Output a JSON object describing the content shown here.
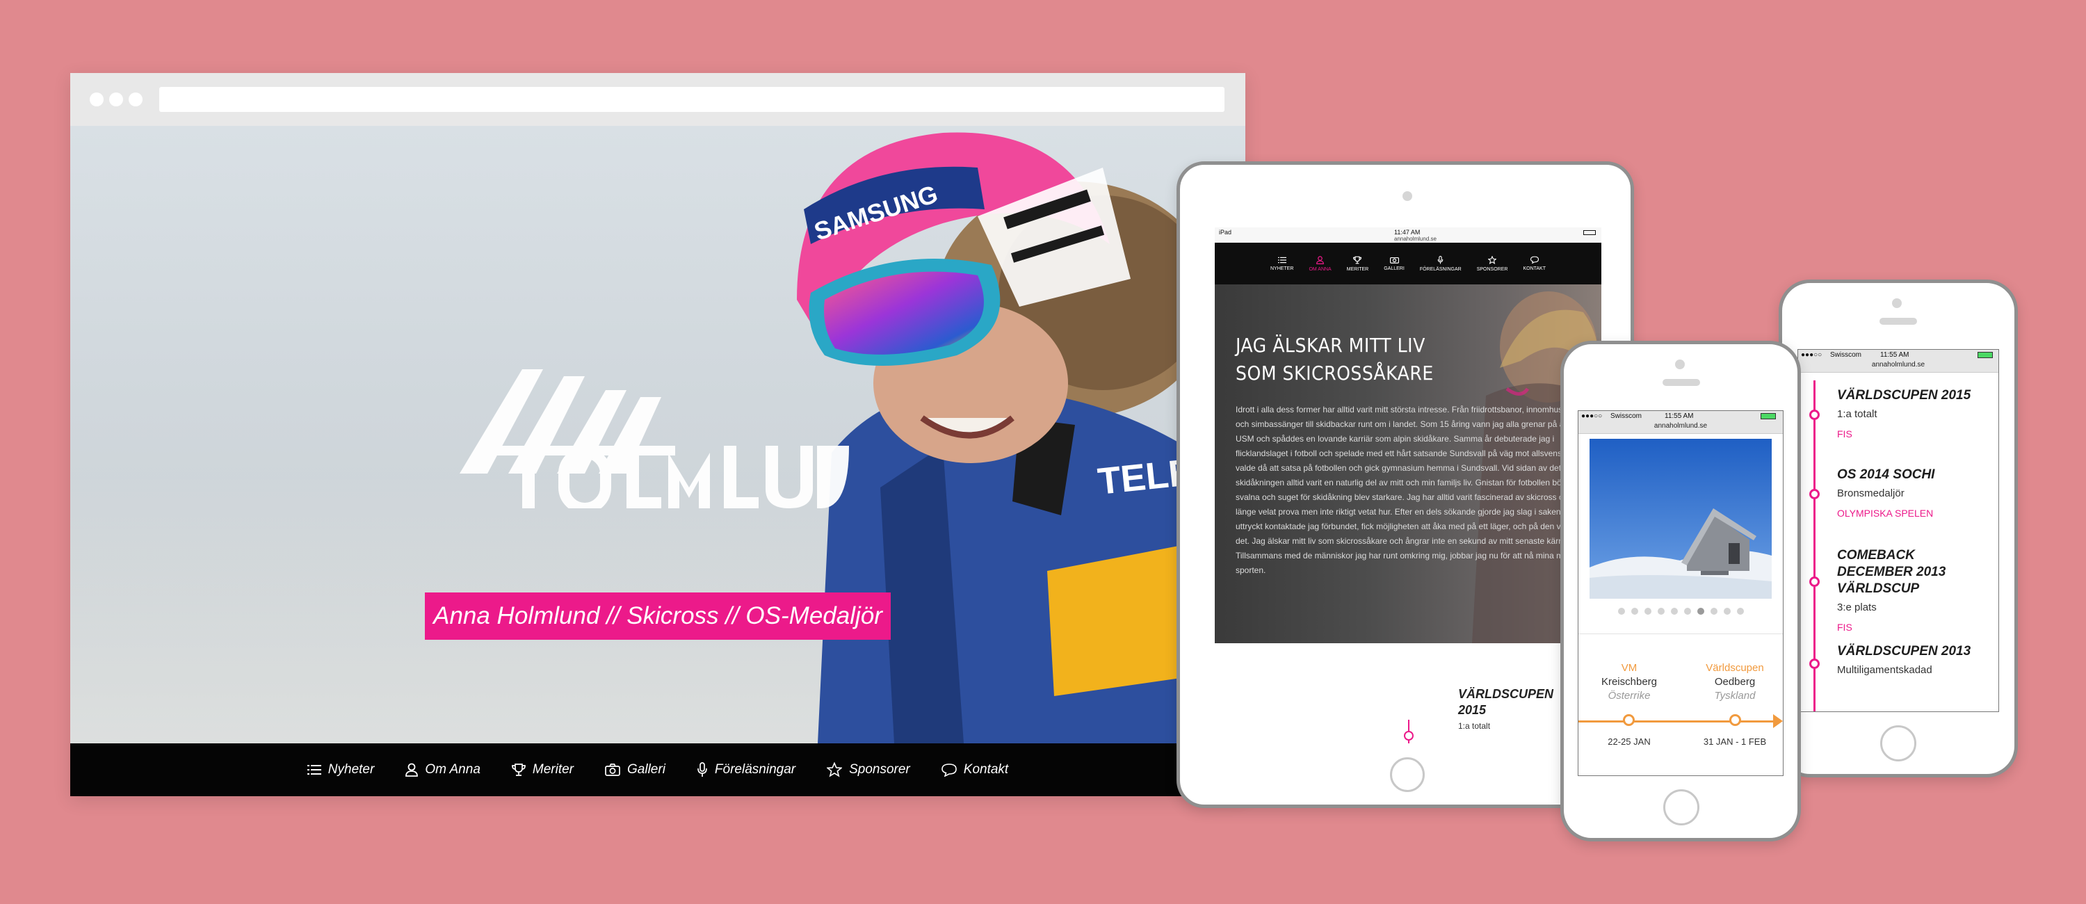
{
  "desktop": {
    "tagline": "Anna Holmlund // Skicross // OS-Medaljör",
    "nav": [
      {
        "label": "Nyheter",
        "icon": "list-icon"
      },
      {
        "label": "Om Anna",
        "icon": "user-icon"
      },
      {
        "label": "Meriter",
        "icon": "trophy-icon"
      },
      {
        "label": "Galleri",
        "icon": "camera-icon"
      },
      {
        "label": "Föreläsningar",
        "icon": "microphone-icon"
      },
      {
        "label": "Sponsorer",
        "icon": "star-icon"
      },
      {
        "label": "Kontakt",
        "icon": "chat-icon"
      }
    ],
    "logo_text": "ANNA HOLMLUND",
    "goggle_brand": "SAMSUNG",
    "jacket_brand": "TELE2"
  },
  "tablet": {
    "status_left": "iPad",
    "status_time": "11:47 AM",
    "url": "annaholmlund.se",
    "nav": [
      {
        "label": "NYHETER",
        "icon": "list-icon"
      },
      {
        "label": "OM ANNA",
        "icon": "user-icon"
      },
      {
        "label": "MERITER",
        "icon": "trophy-icon"
      },
      {
        "label": "GALLERI",
        "icon": "camera-icon"
      },
      {
        "label": "FÖRELÄSNINGAR",
        "icon": "microphone-icon"
      },
      {
        "label": "SPONSORER",
        "icon": "star-icon"
      },
      {
        "label": "KONTAKT",
        "icon": "chat-icon"
      }
    ],
    "hero_title": "JAG ÄLSKAR MITT LIV SOM SKICROSSÅKARE",
    "hero_body": "Idrott i alla dess former har alltid varit mitt största intresse. Från friidrottsbanor, innomhushallar och simbassänger till skidbackar runt om i landet. Som 15 åring vann jag alla grenar på alpina USM och spåddes en lovande karriär som alpin skidåkare. Samma år debuterade jag i flicklandslaget i fotboll och spelade med ett hårt satsande Sundsvall på väg mot allsvenskan. Jag valde då att satsa på fotbollen och gick gymnasium hemma i Sundsvall. Vid sidan av detta har skidåkningen alltid varit en naturlig del av mitt och min familjs liv. Gnistan för fotbollen började svalna och suget för skidåkning blev starkare. Jag har alltid varit fascinerad av skicross och hade länge velat prova men inte riktigt vetat hur. Efter en dels sökande gjorde jag slag i saken, enkelt uttryckt kontaktade jag förbundet, fick möjligheten att åka med på ett läger, och på den vägen är det. Jag älskar mitt liv som skicrossåkare och ångrar inte en sekund av mitt senaste kärnår val. Tillsammans med de människor jag har runt omkring mig, jobbar jag nu för att nå mina mål inom sporten.",
    "results_heading": "VÄRLDSCUPEN 2015",
    "results_sub": "1:a totalt"
  },
  "phone_mid": {
    "status_carrier": "Swisscom",
    "status_time": "11:55 AM",
    "url": "annaholmlund.se",
    "slides_total": 10,
    "slides_active_index": 6,
    "events": [
      {
        "type": "VM",
        "place": "Kreischberg",
        "country": "Österrike",
        "date": "22-25 JAN"
      },
      {
        "type": "Världscupen",
        "place": "Oedberg",
        "country": "Tyskland",
        "date": "31 JAN - 1 FEB"
      }
    ]
  },
  "phone_right": {
    "status_carrier": "Swisscom",
    "status_time": "11:55 AM",
    "url": "annaholmlund.se",
    "timeline": [
      {
        "title": "VÄRLDSCUPEN 2015",
        "sub": "1:a totalt",
        "tag": "FIS"
      },
      {
        "title": "OS 2014 SOCHI",
        "sub": "Bronsmedaljör",
        "tag": "OLYMPISKA SPELEN"
      },
      {
        "title": "COMEBACK DECEMBER 2013 VÄRLDSCUP",
        "sub": "3:e plats",
        "tag": "FIS"
      },
      {
        "title": "VÄRLDSCUPEN 2013",
        "sub": "Multiligamentskadad",
        "tag": ""
      }
    ]
  },
  "colors": {
    "background": "#e0898e",
    "accent": "#ec1a8a",
    "timeline_orange": "#f19a3e",
    "nav_bg": "#050505"
  }
}
